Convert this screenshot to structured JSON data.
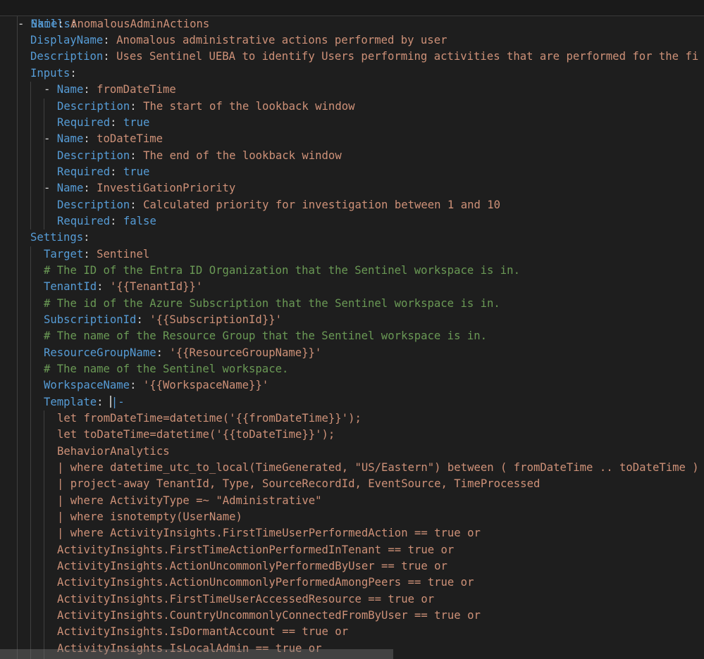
{
  "yaml": {
    "skills_key": "Skills",
    "name_key": "Name",
    "name": "AnomalousAdminActions",
    "display_name_key": "DisplayName",
    "display_name": "Anomalous administrative actions performed by user",
    "description_key": "Description",
    "description": "Uses Sentinel UEBA to identify Users performing activities that are performed for the fi",
    "inputs_key": "Inputs",
    "required_key": "Required",
    "inputs": [
      {
        "name": "fromDateTime",
        "description": "The start of the lookback window",
        "required": "true"
      },
      {
        "name": "toDateTime",
        "description": "The end of the lookback window",
        "required": "true"
      },
      {
        "name": "InvestiGationPriority",
        "description": "Calculated priority for investigation between 1 and 10",
        "required": "false"
      }
    ],
    "settings_key": "Settings",
    "target_key": "Target",
    "target": "Sentinel",
    "comment_tenant": "# The ID of the Entra ID Organization that the Sentinel workspace is in.",
    "tenant_key": "TenantId",
    "tenant": "'{{TenantId}}'",
    "comment_subscription": "# The id of the Azure Subscription that the Sentinel workspace is in.",
    "subscription_key": "SubscriptionId",
    "subscription": "'{{SubscriptionId}}'",
    "comment_rg": "# The name of the Resource Group that the Sentinel workspace is in.",
    "rg_key": "ResourceGroupName",
    "rg": "'{{ResourceGroupName}}'",
    "comment_ws": "# The name of the Sentinel workspace.",
    "ws_key": "WorkspaceName",
    "ws": "'{{WorkspaceName}}'",
    "template_key": "Template",
    "template_indicator": "|-",
    "template_lines": [
      "let fromDateTime=datetime('{{fromDateTime}}');",
      "let toDateTime=datetime('{{toDateTime}}');",
      "BehaviorAnalytics",
      "| where datetime_utc_to_local(TimeGenerated, \"US/Eastern\") between ( fromDateTime .. toDateTime )",
      "| project-away TenantId, Type, SourceRecordId, EventSource, TimeProcessed",
      "| where ActivityType =~ \"Administrative\"",
      "| where isnotempty(UserName)",
      "| where ActivityInsights.FirstTimeUserPerformedAction == true or",
      "ActivityInsights.FirstTimeActionPerformedInTenant == true or",
      "ActivityInsights.ActionUncommonlyPerformedByUser == true or",
      "ActivityInsights.ActionUncommonlyPerformedAmongPeers == true or",
      "ActivityInsights.FirstTimeUserAccessedResource == true or",
      "ActivityInsights.CountryUncommonlyConnectedFromByUser == true or",
      "ActivityInsights.IsDormantAccount == true or",
      "ActivityInsights.IsLocalAdmin == true or"
    ]
  }
}
